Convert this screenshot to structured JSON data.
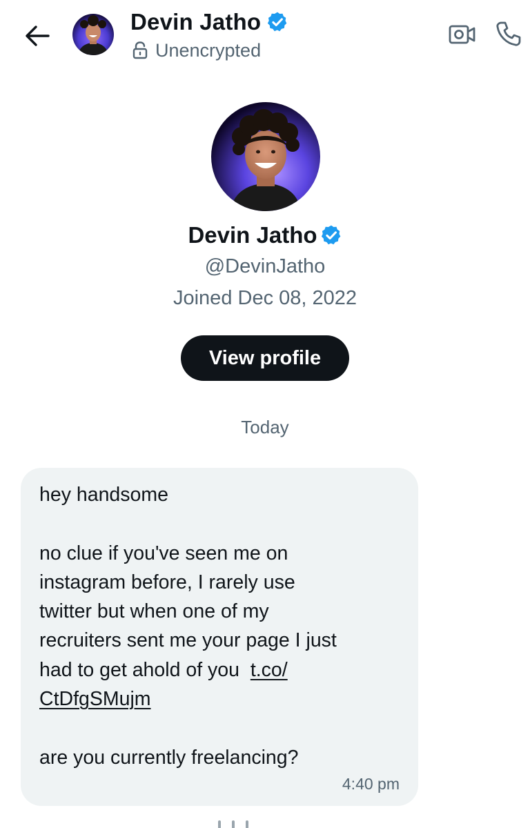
{
  "header": {
    "back_icon": "arrow-left-icon",
    "name": "Devin Jatho",
    "verified": true,
    "verified_color": "#1d9bf0",
    "encryption_status": "Unencrypted",
    "lock_icon": "unlock-icon",
    "actions": [
      {
        "name": "video-call",
        "icon": "video-icon"
      },
      {
        "name": "voice-call",
        "icon": "phone-icon"
      }
    ]
  },
  "profile": {
    "name": "Devin Jatho",
    "handle": "@DevinJatho",
    "joined": "Joined Dec 08, 2022",
    "view_profile_label": "View profile"
  },
  "conversation": {
    "date_divider": "Today",
    "messages": [
      {
        "text_before_link": "hey handsome\n\nno clue if you've seen me on\ninstagram before, I rarely use\ntwitter but when one of my\nrecruiters sent me your page I just\nhad to get ahold of you  ",
        "link_text": "t.co/\nCtDfgSMujm",
        "text_after_link": "\n\nare you currently freelancing?",
        "time": "4:40 pm"
      }
    ]
  },
  "colors": {
    "text_primary": "#0f1419",
    "text_secondary": "#536471",
    "bubble_bg": "#eff3f4",
    "button_bg": "#0f1419",
    "accent": "#1d9bf0"
  }
}
